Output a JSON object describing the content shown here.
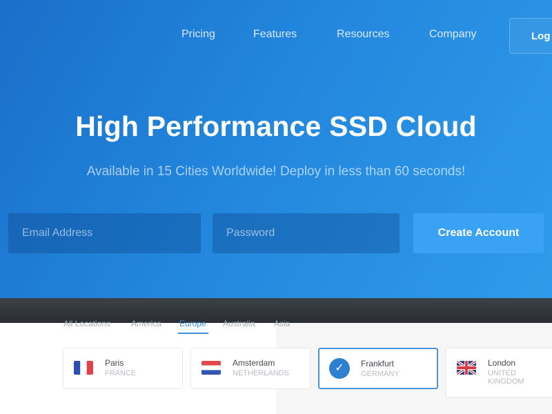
{
  "nav": {
    "links": [
      "Pricing",
      "Features",
      "Resources",
      "Company"
    ],
    "login_label": "Log In"
  },
  "hero": {
    "title": "High Performance SSD Cloud",
    "subtitle": "Available in 15 Cities Worldwide! Deploy in less than 60 seconds!"
  },
  "signup": {
    "email_placeholder": "Email Address",
    "password_placeholder": "Password",
    "submit_label": "Create Account"
  },
  "locations": {
    "tabs": [
      "All Locations",
      "America",
      "Europe",
      "Australia",
      "Asia"
    ],
    "active_tab": "Europe",
    "cards": [
      {
        "city": "Paris",
        "country": "FRANCE",
        "flag": "france-flag-icon",
        "selected": false
      },
      {
        "city": "Amsterdam",
        "country": "NETHERLANDS",
        "flag": "netherlands-flag-icon",
        "selected": false
      },
      {
        "city": "Frankfurt",
        "country": "GERMANY",
        "flag": "check-icon",
        "selected": true
      },
      {
        "city": "London",
        "country": "UNITED KINGDOM",
        "flag": "uk-flag-icon",
        "selected": false
      }
    ]
  },
  "colors": {
    "hero_start": "#1a6fc9",
    "hero_end": "#2f9be9",
    "accent": "#3aa2f4",
    "selected_border": "#4a95dc"
  }
}
